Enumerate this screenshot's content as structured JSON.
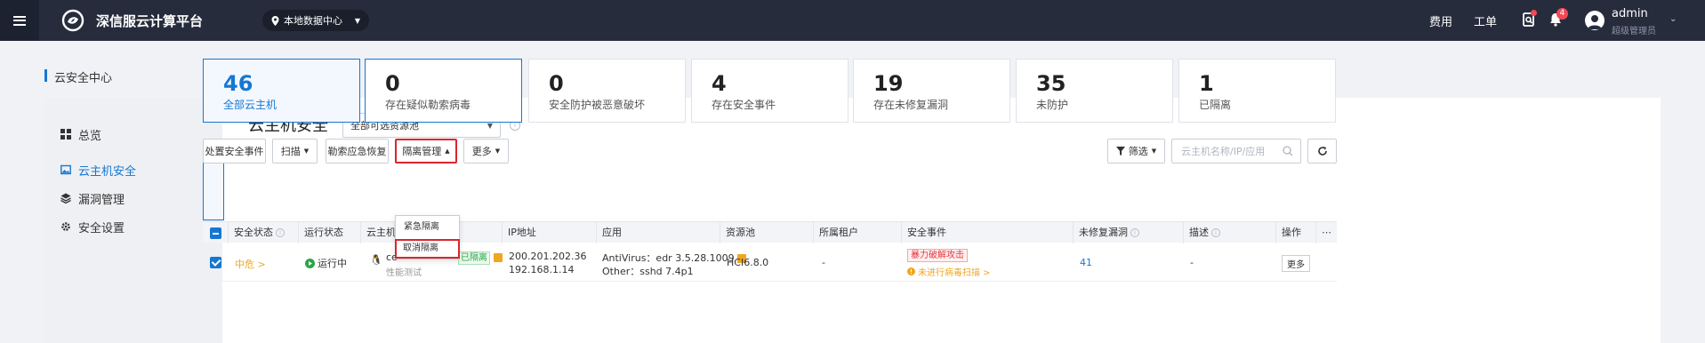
{
  "topbar": {
    "brand": "深信服云计算平台",
    "datacenter": "本地数据中心",
    "links": [
      "费用",
      "工单"
    ],
    "notification_count": "4",
    "user_name": "admin",
    "user_role": "超级管理员"
  },
  "page": {
    "title": "云安全中心"
  },
  "sidebar": {
    "items": [
      {
        "label": "总览",
        "icon": "grid-icon"
      },
      {
        "label": "云主机安全",
        "icon": "image-icon"
      },
      {
        "label": "漏洞管理",
        "icon": "stack-icon"
      },
      {
        "label": "安全设置",
        "icon": "gear-icon"
      }
    ],
    "active_index": 1
  },
  "main": {
    "title": "云主机安全",
    "pool_select": "全部可选资源池"
  },
  "stats": [
    {
      "value": "46",
      "label": "全部云主机"
    },
    {
      "value": "0",
      "label": "存在疑似勒索病毒"
    },
    {
      "value": "0",
      "label": "安全防护被恶意破坏"
    },
    {
      "value": "4",
      "label": "存在安全事件"
    },
    {
      "value": "19",
      "label": "存在未修复漏洞"
    },
    {
      "value": "35",
      "label": "未防护"
    },
    {
      "value": "1",
      "label": "已隔离"
    }
  ],
  "toolbar": {
    "handle_event": "处置安全事件",
    "scan": "扫描",
    "ransom_restore": "勒索应急恢复",
    "isolation": "隔离管理",
    "more": "更多",
    "filter": "筛选",
    "search_placeholder": "云主机名称/IP/应用"
  },
  "isolation_menu": {
    "items": [
      "紧急隔离",
      "取消隔离"
    ]
  },
  "table": {
    "headers": [
      "安全状态",
      "运行状态",
      "云主机名",
      "IP地址",
      "应用",
      "资源池",
      "所属租户",
      "安全事件",
      "未修复漏洞",
      "描述",
      "操作"
    ],
    "row": {
      "security_status": "中危 >",
      "run_status": "运行中",
      "vm_name_fragment": "ce",
      "vm_sub": "性能测试",
      "isolated_tag": "已隔离",
      "ip1": "200.201.202.36",
      "ip2": "192.168.1.14",
      "app1": "AntiVirus：edr 3.5.28.1009",
      "app2": "Other：sshd 7.4p1",
      "pool": "HCI6.8.0",
      "tenant": "-",
      "event_tag": "暴力破解攻击",
      "event_warn": "未进行病毒扫描 >",
      "vulns": "41",
      "desc": "-",
      "action": "更多"
    }
  },
  "colors": {
    "topbar": "#262c3c",
    "accent": "#1677d2",
    "highlight_border": "#d9262c",
    "medium_risk": "#f0a61f",
    "running": "#29a745",
    "danger": "#e8353d"
  }
}
